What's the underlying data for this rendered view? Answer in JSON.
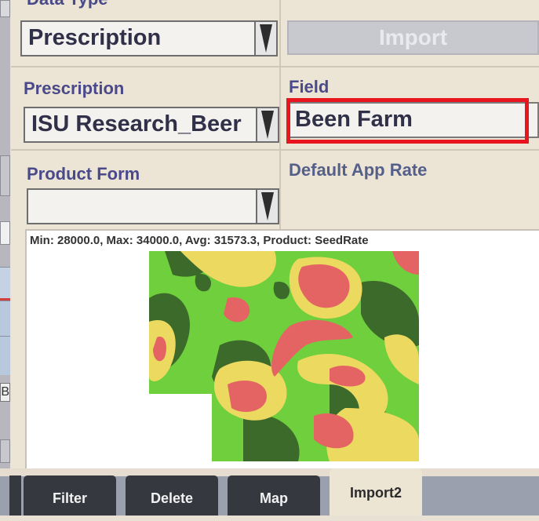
{
  "header": {
    "data_type_label": "Data Type"
  },
  "data_type": {
    "value": "Prescription",
    "arrow_icon": "dropdown-arrow-icon"
  },
  "import_button": {
    "label": "Import",
    "enabled": false
  },
  "prescription": {
    "label": "Prescription",
    "value": "ISU Research_Beer"
  },
  "field": {
    "label": "Field",
    "value": "Been Farm",
    "highlight_color": "#e8141e"
  },
  "product_form": {
    "label": "Product Form",
    "value": ""
  },
  "default_app_rate": {
    "label": "Default App Rate"
  },
  "map": {
    "info": "Min: 28000.0, Max: 34000.0, Avg: 31573.3, Product: SeedRate",
    "zone_colors": [
      "#e46464",
      "#ecd960",
      "#6fcf3c",
      "#3c6a2a"
    ]
  },
  "left_panel": {
    "letter": "B"
  },
  "tabs": [
    {
      "label": "Filter"
    },
    {
      "label": "Delete"
    },
    {
      "label": "Map"
    },
    {
      "label": "Import2",
      "active": true
    }
  ]
}
